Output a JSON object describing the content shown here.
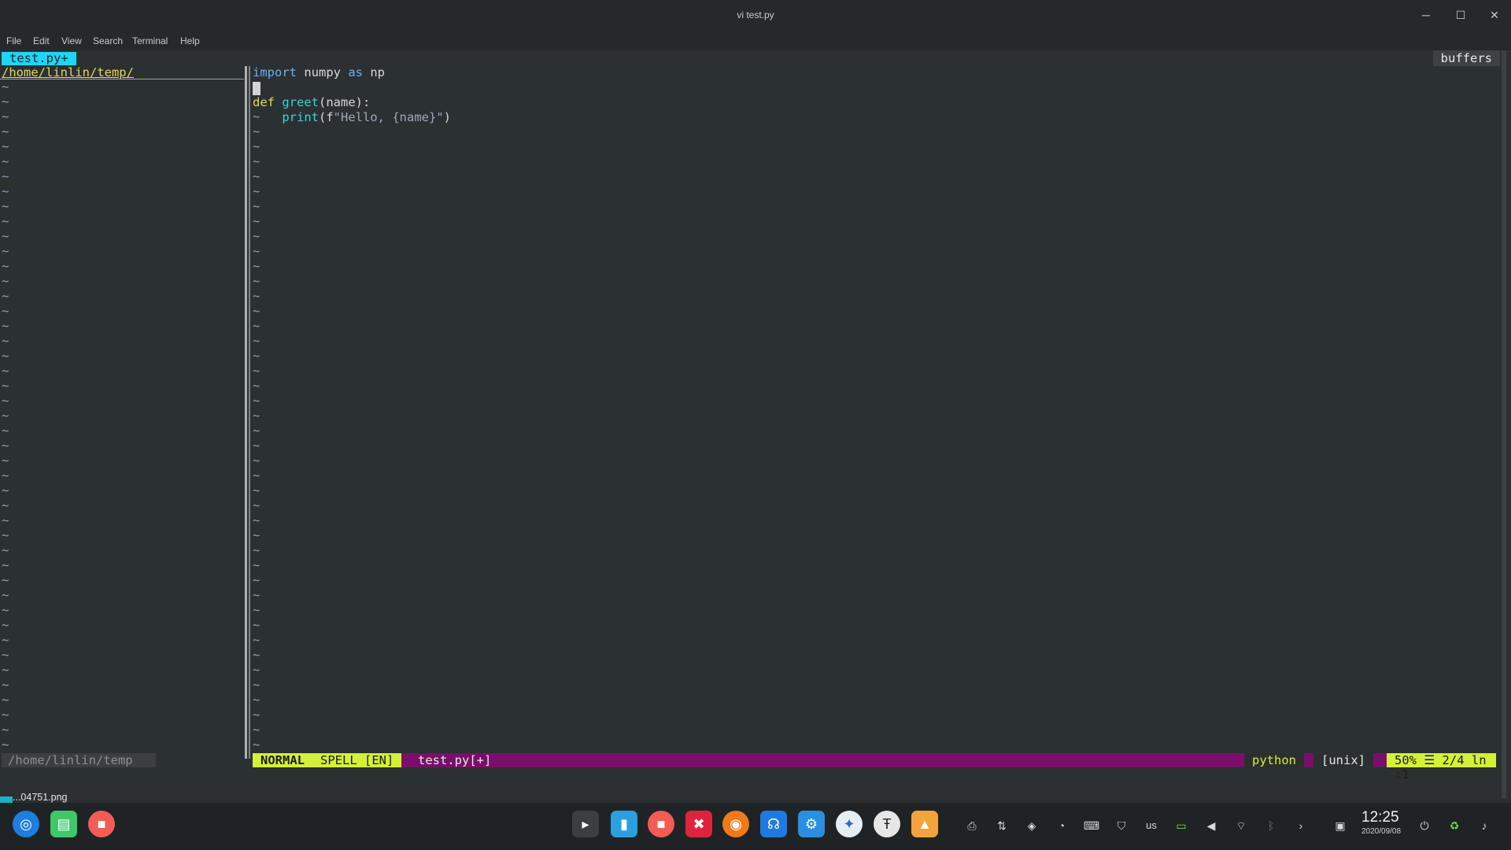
{
  "window": {
    "title": "vi test.py",
    "min": "─",
    "max": "☐",
    "close": "✕"
  },
  "menu": [
    "File",
    "Edit",
    "View",
    "Search",
    "Terminal",
    "Help"
  ],
  "vim": {
    "tab_active": "test.py+",
    "buffers_label": "buffers",
    "tree_root": "/home/linlin/temp/",
    "code": {
      "line1": {
        "kw": "import",
        "rest1": " numpy ",
        "kw2": "as",
        "rest2": " np"
      },
      "line3": {
        "kw": "def",
        "fn": "greet",
        "rest": "(name):"
      },
      "line4": {
        "indent": "    ",
        "fn": "print",
        "p1": "(f",
        "str": "\"Hello, {name}\"",
        "p2": ")"
      }
    },
    "tilde": "~",
    "status": {
      "left_path": "/home/linlin/temp",
      "mode": "NORMAL",
      "spell": "SPELL [EN]",
      "file": "test.py[+]",
      "filetype": "python",
      "fileformat": "[unix]",
      "position": "50% ☰ 2/4 ln :1"
    }
  },
  "taskbar": {
    "preview_file": "...04751.png",
    "keyboard_layout": "us",
    "time": "12:25",
    "date": "2020/09/08"
  }
}
